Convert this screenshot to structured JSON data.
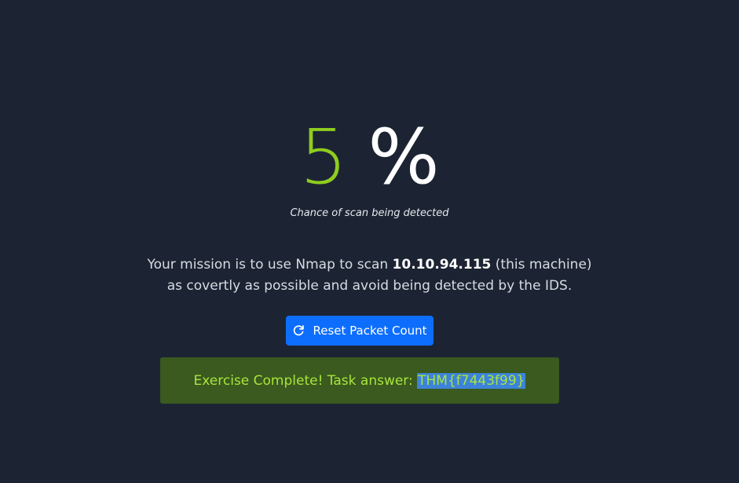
{
  "detection": {
    "value": "5",
    "sign": "%",
    "caption": "Chance of scan being detected"
  },
  "mission": {
    "prefix": "Your mission is to use Nmap to scan ",
    "ip": "10.10.94.115",
    "suffix": " (this machine)",
    "line2": "as covertly as possible and avoid being detected by the IDS."
  },
  "reset_button": {
    "label": "Reset Packet Count",
    "icon": "refresh-icon"
  },
  "banner": {
    "text": "Exercise Complete! Task answer: ",
    "answer": "THM{f7443f99}"
  },
  "colors": {
    "background": "#1c2433",
    "percent_value": "#8fcc1f",
    "button": "#0d6efd",
    "banner_bg": "#3a5a1f",
    "banner_text": "#a8e63a",
    "selection": "#3d83d9"
  }
}
